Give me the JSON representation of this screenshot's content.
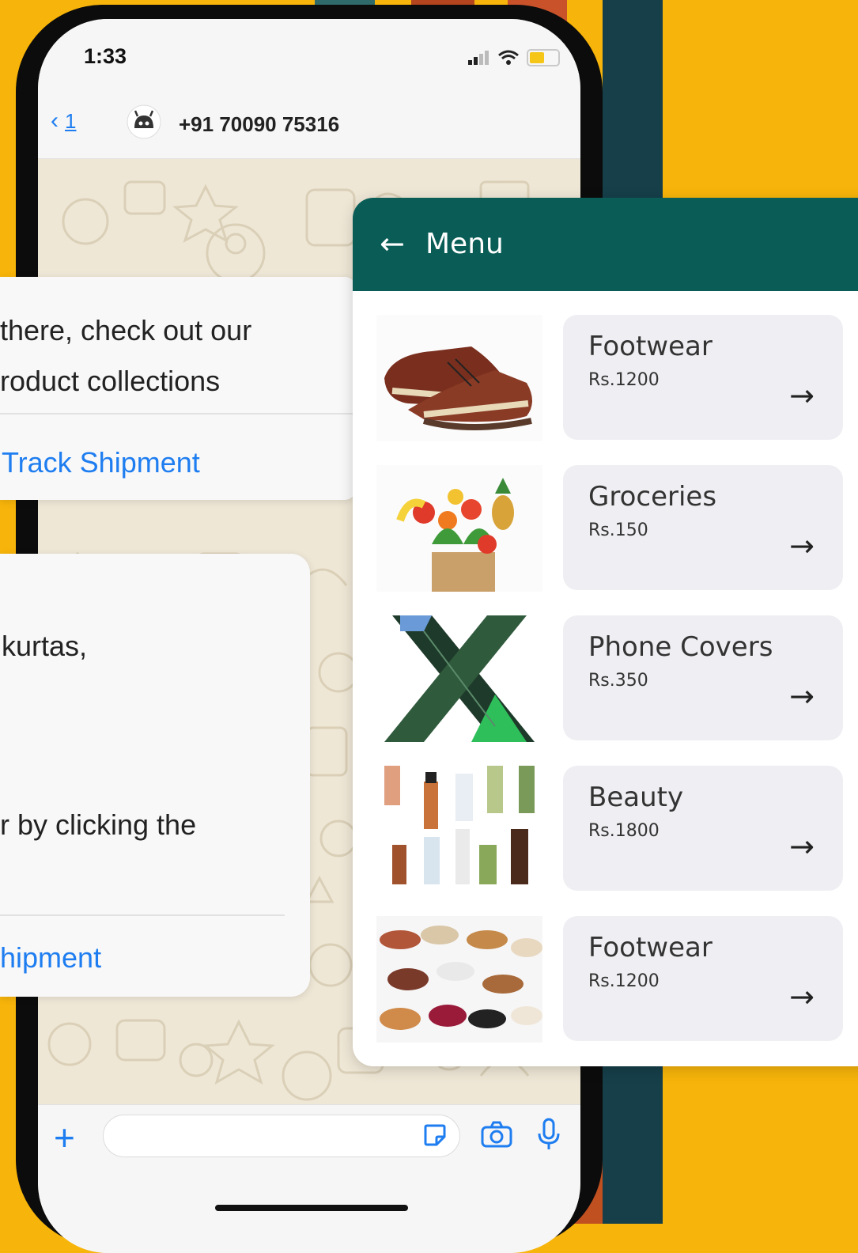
{
  "status_bar": {
    "time": "1:33"
  },
  "chat_header": {
    "back_count": "1",
    "contact": "+91 70090 75316"
  },
  "messages": {
    "first": {
      "line1": "there, check out our",
      "line2": "roduct collections",
      "action": "Track Shipment"
    },
    "second": {
      "line1": "kurtas,",
      "line2": "r by clicking the",
      "action": "hipment"
    }
  },
  "menu": {
    "title": "Menu",
    "items": [
      {
        "name": "Footwear",
        "price": "Rs.1200",
        "image": "brown-shoes"
      },
      {
        "name": "Groceries",
        "price": "Rs.150",
        "image": "grocery-bag"
      },
      {
        "name": "Phone Covers",
        "price": "Rs.350",
        "image": "phone-case"
      },
      {
        "name": "Beauty",
        "price": "Rs.1800",
        "image": "cosmetics"
      },
      {
        "name": "Footwear",
        "price": "Rs.1200",
        "image": "shoe-pile"
      }
    ]
  },
  "colors": {
    "background": "#F7B40A",
    "menu_header": "#0A5D56",
    "link": "#1E7DF0",
    "navy_stripe": "#163F4A"
  }
}
